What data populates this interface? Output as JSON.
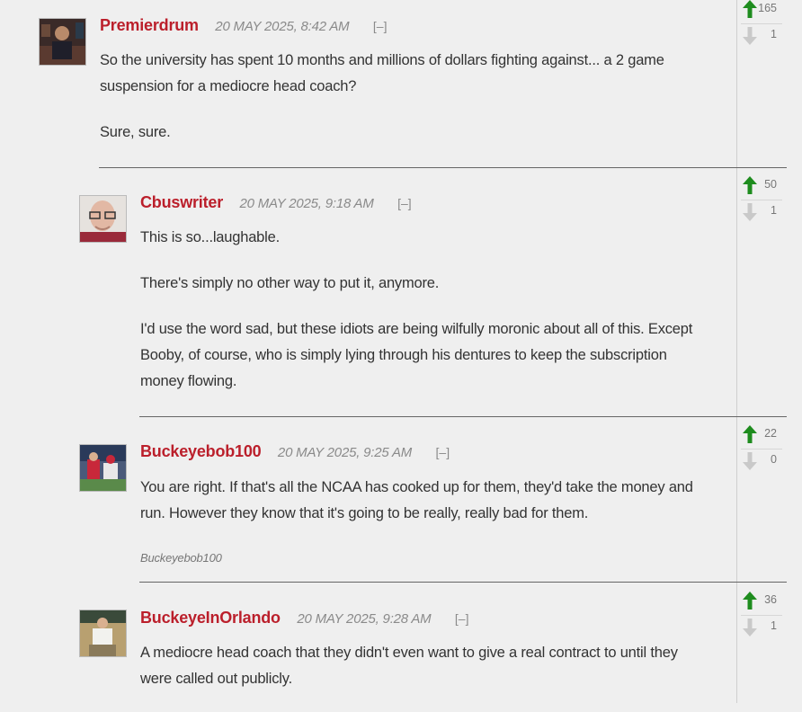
{
  "colors": {
    "username": "#bb1f2b",
    "upvote": "#1e8c1e",
    "downvote": "#c9c9c9",
    "background": "#efefef"
  },
  "comments": [
    {
      "username": "Premierdrum",
      "timestamp": "20 MAY 2025, 8:42 AM",
      "collapse": "[–]",
      "paragraphs": [
        "So the university has spent 10 months and millions of dollars fighting against... a 2 game suspension for a mediocre head coach?",
        "Sure, sure."
      ],
      "signature": "",
      "upvotes": "165",
      "downvotes": "1"
    },
    {
      "username": "Cbuswriter",
      "timestamp": "20 MAY 2025, 9:18 AM",
      "collapse": "[–]",
      "paragraphs": [
        "This is so...laughable.",
        "There's simply no other way to put it, anymore.",
        "I'd use the word sad, but these idiots are being wilfully moronic about all of this. Except Booby, of course, who is simply lying through his dentures to keep the subscription money flowing."
      ],
      "signature": "",
      "upvotes": "50",
      "downvotes": "1"
    },
    {
      "username": "Buckeyebob100",
      "timestamp": "20 MAY 2025, 9:25 AM",
      "collapse": "[–]",
      "paragraphs": [
        "You are right.  If that's all the NCAA has cooked up for them, they'd take the money and run.  However they know that it's going to be really, really bad for them."
      ],
      "signature": "Buckeyebob100",
      "upvotes": "22",
      "downvotes": "0"
    },
    {
      "username": "BuckeyeInOrlando",
      "timestamp": "20 MAY 2025, 9:28 AM",
      "collapse": "[–]",
      "paragraphs": [
        "A mediocre head coach that they didn't even want to give a real contract to until they were called out publicly."
      ],
      "signature": "",
      "upvotes": "36",
      "downvotes": "1"
    }
  ]
}
